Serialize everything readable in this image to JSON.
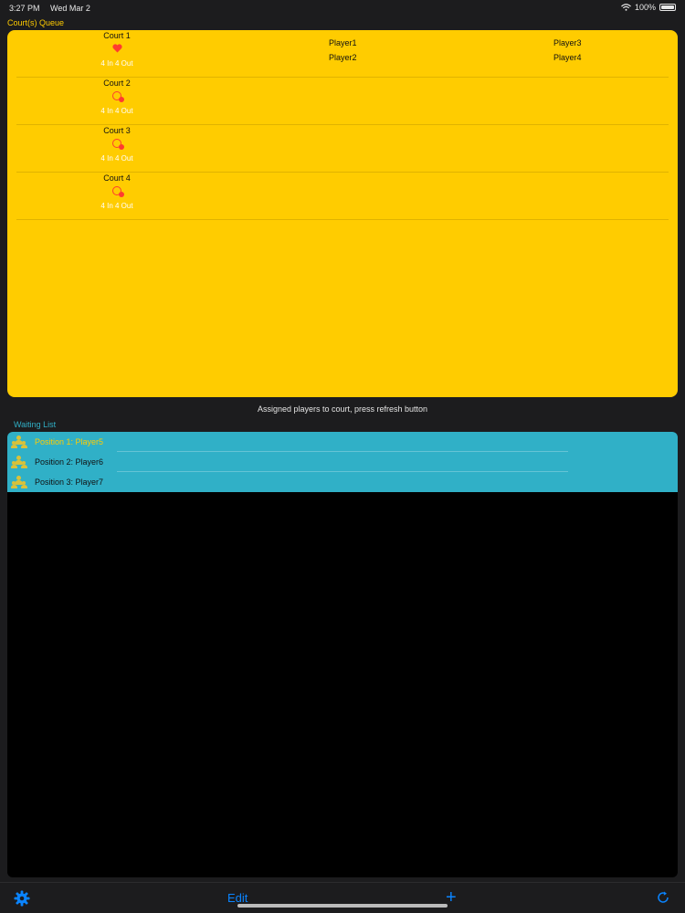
{
  "status_bar": {
    "time": "3:27 PM",
    "date": "Wed Mar 2",
    "battery_text": "100%"
  },
  "courts_section": {
    "title": "Court(s) Queue",
    "courts": [
      {
        "name": "Court 1",
        "icon": "heart-icon",
        "subtitle": "4 In 4 Out",
        "players": [
          "Player1",
          "Player2",
          "Player3",
          "Player4"
        ]
      },
      {
        "name": "Court 2",
        "icon": "hourglass-badge-icon",
        "subtitle": "4 In 4 Out",
        "players": []
      },
      {
        "name": "Court 3",
        "icon": "hourglass-badge-icon",
        "subtitle": "4 In 4 Out",
        "players": []
      },
      {
        "name": "Court 4",
        "icon": "hourglass-badge-icon",
        "subtitle": "4 In 4 Out",
        "players": []
      }
    ]
  },
  "hint": "Assigned players to court, press refresh button",
  "waiting_section": {
    "title": "Waiting List",
    "items": [
      {
        "label": "Position 1: Player5"
      },
      {
        "label": "Position 2: Player6"
      },
      {
        "label": "Position 3: Player7"
      }
    ]
  },
  "toolbar": {
    "edit_label": "Edit",
    "add_label": "+"
  },
  "colors": {
    "courts_bg": "#ffcc00",
    "waiting_bg": "#30b0c7",
    "accent": "#0a84ff",
    "alert": "#ff3b30"
  }
}
